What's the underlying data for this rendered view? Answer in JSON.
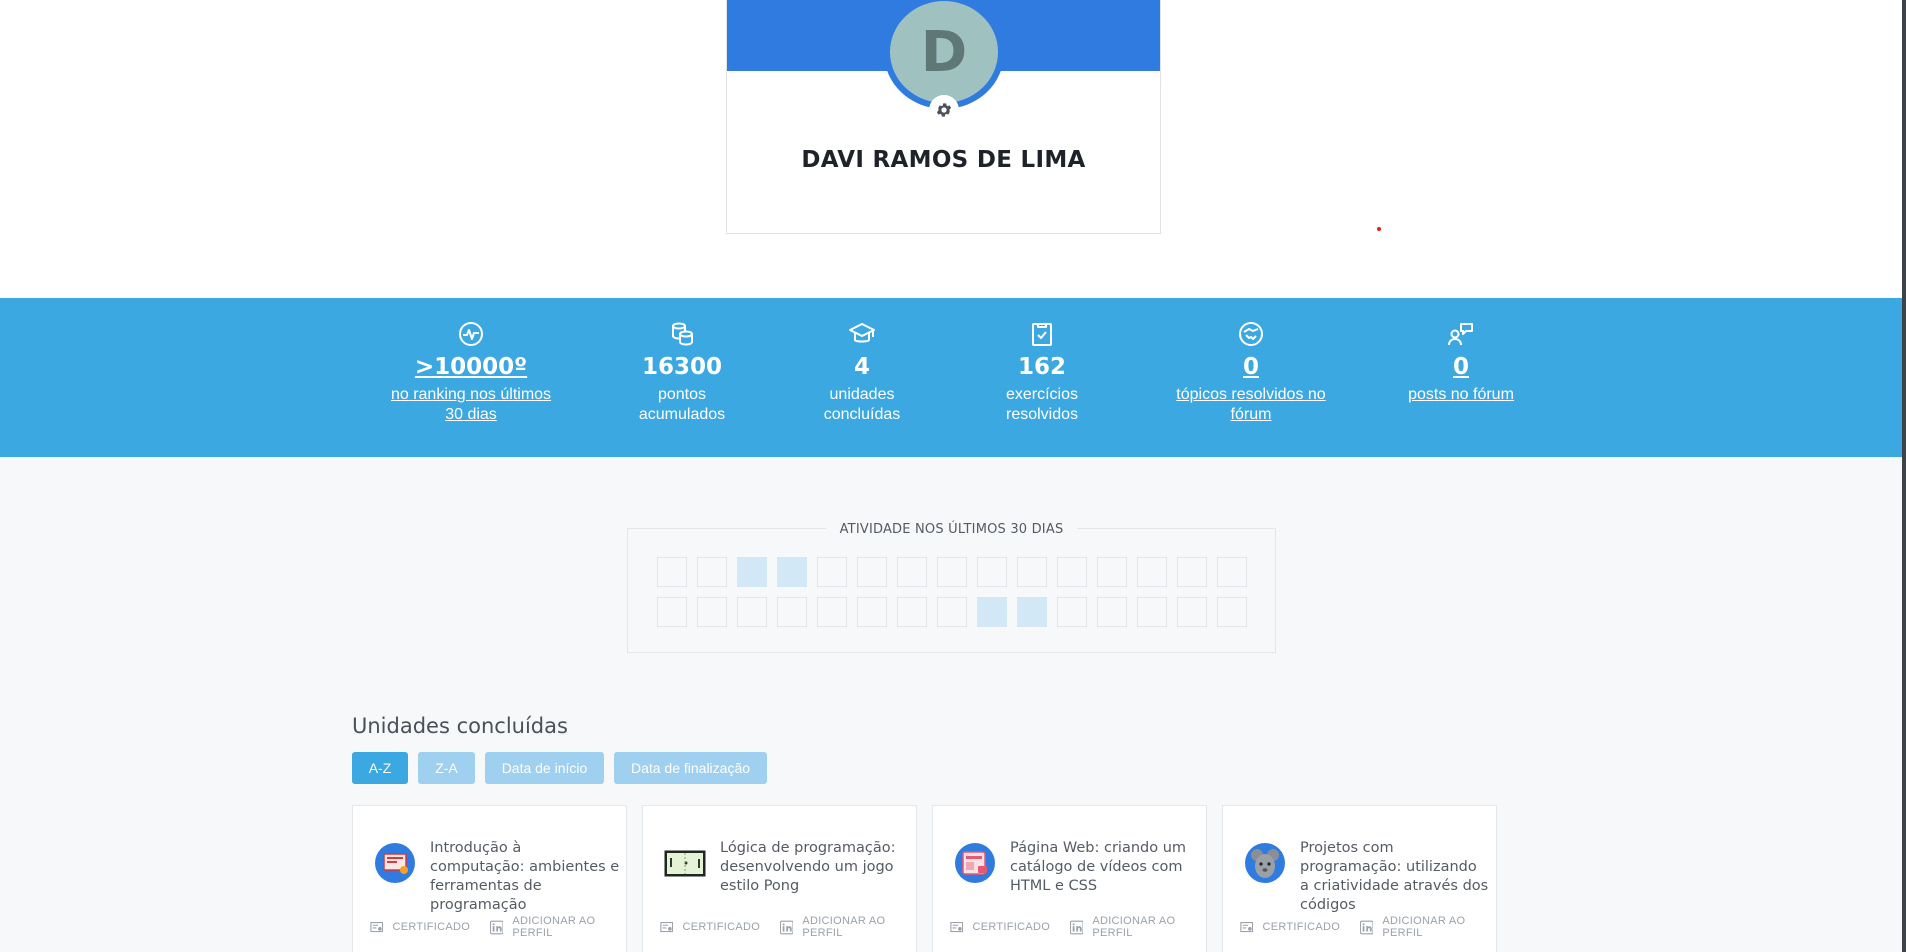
{
  "profile": {
    "avatar_initial": "D",
    "name": "DAVI RAMOS DE LIMA"
  },
  "stats": [
    {
      "icon": "activity-pulse-icon",
      "value": ">10000º",
      "label": "no ranking nos últimos 30 dias",
      "link": true
    },
    {
      "icon": "coins-icon",
      "value": "16300",
      "label": "pontos acumulados",
      "link": false
    },
    {
      "icon": "graduation-cap-icon",
      "value": "4",
      "label": "unidades concluídas",
      "link": false
    },
    {
      "icon": "clipboard-check-icon",
      "value": "162",
      "label": "exercícios resolvidos",
      "link": false
    },
    {
      "icon": "handshake-icon",
      "value": "0",
      "label": "tópicos resolvidos no fórum",
      "link": true
    },
    {
      "icon": "user-message-icon",
      "value": "0",
      "label": "posts no fórum",
      "link": true
    }
  ],
  "activity": {
    "title": "ATIVIDADE NOS ÚLTIMOS 30 DIAS",
    "row1": [
      0,
      0,
      1,
      1,
      0,
      0,
      0,
      0,
      0,
      0,
      0,
      0,
      0,
      0,
      0
    ],
    "row2": [
      0,
      0,
      0,
      0,
      0,
      0,
      0,
      0,
      1,
      1,
      0,
      0,
      0,
      0,
      0
    ]
  },
  "completed": {
    "title": "Unidades concluídas",
    "sort_buttons": [
      {
        "label": "A-Z",
        "active": true
      },
      {
        "label": "Z-A",
        "active": false
      },
      {
        "label": "Data de início",
        "active": false
      },
      {
        "label": "Data de finalização",
        "active": false
      }
    ],
    "cards": [
      {
        "title": "Introdução à computação: ambientes e ferramentas de programação",
        "icon": "computer-tools-icon",
        "cert": "CERTIFICADO",
        "add": "ADICIONAR AO PERFIL"
      },
      {
        "title": "Lógica de programação: desenvolvendo um jogo estilo Pong",
        "icon": "pong-game-icon",
        "cert": "CERTIFICADO",
        "add": "ADICIONAR AO PERFIL"
      },
      {
        "title": "Página Web: criando um catálogo de vídeos com HTML e CSS",
        "icon": "web-page-icon",
        "cert": "CERTIFICADO",
        "add": "ADICIONAR AO PERFIL"
      },
      {
        "title": "Projetos com programação: utilizando a criatividade através dos códigos",
        "icon": "mouse-mascot-icon",
        "cert": "CERTIFICADO",
        "add": "ADICIONAR AO PERFIL"
      }
    ]
  },
  "colors": {
    "brand_blue": "#2f7be0",
    "stats_blue": "#3ca8e2",
    "active_cell": "#d3e8f6"
  }
}
